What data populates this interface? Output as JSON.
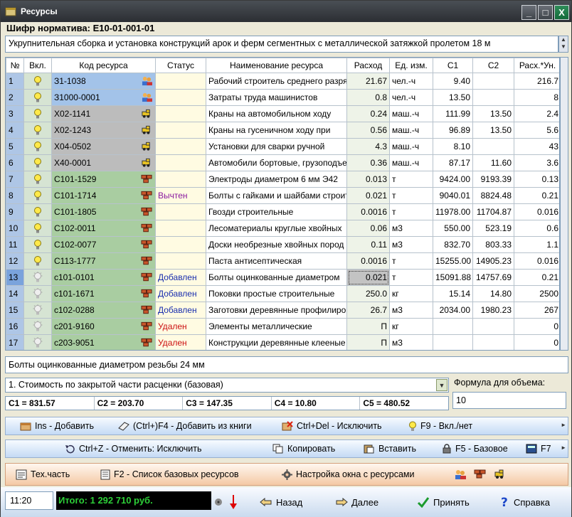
{
  "window": {
    "title": "Ресурсы",
    "minimize": "_",
    "maximize": "□",
    "close": "X"
  },
  "shifr": "Шифр норматива: Е10-01-001-01",
  "description": "Укрупнительная сборка и установка конструкций арок и ферм сегментных с металлической затяжкой пролетом 18 м",
  "columns": [
    "№",
    "Вкл.",
    "Код ресурса",
    "Статус",
    "Наименование ресурса",
    "Расход",
    "Ед. изм.",
    "С1",
    "С2",
    "Расх.*Ун."
  ],
  "rows": [
    {
      "n": "1",
      "on": true,
      "code": "З1-1038",
      "cat": "blue",
      "icon": "workers-icon",
      "status": "",
      "st": "",
      "name": "Рабочий строитель среднего разряда",
      "ras": "21.67",
      "ed": "чел.-ч",
      "c1": "9.40",
      "c2": "",
      "ru": "216.7"
    },
    {
      "n": "2",
      "on": true,
      "code": "З1000-0001",
      "cat": "blue",
      "icon": "workers-icon",
      "status": "",
      "st": "",
      "name": "Затраты труда машинистов",
      "ras": "0.8",
      "ed": "чел.-ч",
      "c1": "13.50",
      "c2": "",
      "ru": "8"
    },
    {
      "n": "3",
      "on": true,
      "code": "Х02-1141",
      "cat": "gray",
      "icon": "machine-icon",
      "status": "",
      "st": "",
      "name": "Краны на автомобильном ходу",
      "ras": "0.24",
      "ed": "маш.-ч",
      "c1": "111.99",
      "c2": "13.50",
      "ru": "2.4"
    },
    {
      "n": "4",
      "on": true,
      "code": "Х02-1243",
      "cat": "gray",
      "icon": "machine-icon",
      "status": "",
      "st": "",
      "name": "Краны на гусеничном ходу при",
      "ras": "0.56",
      "ed": "маш.-ч",
      "c1": "96.89",
      "c2": "13.50",
      "ru": "5.6"
    },
    {
      "n": "5",
      "on": true,
      "code": "Х04-0502",
      "cat": "gray",
      "icon": "machine-icon",
      "status": "",
      "st": "",
      "name": "Установки для сварки ручной",
      "ras": "4.3",
      "ed": "маш.-ч",
      "c1": "8.10",
      "c2": "",
      "ru": "43"
    },
    {
      "n": "6",
      "on": true,
      "code": "Х40-0001",
      "cat": "gray",
      "icon": "machine-icon",
      "status": "",
      "st": "",
      "name": "Автомобили бортовые, грузоподъемностью",
      "ras": "0.36",
      "ed": "маш.-ч",
      "c1": "87.17",
      "c2": "11.60",
      "ru": "3.6"
    },
    {
      "n": "7",
      "on": true,
      "code": "С101-1529",
      "cat": "green",
      "icon": "bricks-icon",
      "status": "",
      "st": "",
      "name": "Электроды диаметром 6 мм Э42",
      "ras": "0.013",
      "ed": "т",
      "c1": "9424.00",
      "c2": "9193.39",
      "ru": "0.13"
    },
    {
      "n": "8",
      "on": true,
      "code": "С101-1714",
      "cat": "green",
      "icon": "bricks-icon",
      "status": "Вычтен",
      "st": "purple",
      "name": "Болты с гайками и шайбами строительные",
      "ras": "0.021",
      "ed": "т",
      "c1": "9040.01",
      "c2": "8824.48",
      "ru": "0.21"
    },
    {
      "n": "9",
      "on": true,
      "code": "С101-1805",
      "cat": "green",
      "icon": "bricks-icon",
      "status": "",
      "st": "",
      "name": "Гвозди строительные",
      "ras": "0.0016",
      "ed": "т",
      "c1": "11978.00",
      "c2": "11704.87",
      "ru": "0.016"
    },
    {
      "n": "10",
      "on": true,
      "code": "С102-0011",
      "cat": "green",
      "icon": "bricks-icon",
      "status": "",
      "st": "",
      "name": "Лесоматериалы круглые хвойных",
      "ras": "0.06",
      "ed": "м3",
      "c1": "550.00",
      "c2": "523.19",
      "ru": "0.6"
    },
    {
      "n": "11",
      "on": true,
      "code": "С102-0077",
      "cat": "green",
      "icon": "bricks-icon",
      "status": "",
      "st": "",
      "name": "Доски необрезные хвойных пород",
      "ras": "0.11",
      "ed": "м3",
      "c1": "832.70",
      "c2": "803.33",
      "ru": "1.1"
    },
    {
      "n": "12",
      "on": true,
      "code": "С113-1777",
      "cat": "green",
      "icon": "bricks-icon",
      "status": "",
      "st": "",
      "name": "Паста антисептическая",
      "ras": "0.0016",
      "ed": "т",
      "c1": "15255.00",
      "c2": "14905.23",
      "ru": "0.016"
    },
    {
      "n": "13",
      "on": false,
      "code": "с101-0101",
      "cat": "green",
      "icon": "bricks-icon",
      "status": "Добавлен",
      "st": "blue",
      "name": "Болты оцинкованные диаметром",
      "ras": "0.021",
      "ed": "т",
      "c1": "15091.88",
      "c2": "14757.69",
      "ru": "0.21"
    },
    {
      "n": "14",
      "on": false,
      "code": "с101-1671",
      "cat": "green",
      "icon": "bricks-icon",
      "status": "Добавлен",
      "st": "blue",
      "name": "Поковки простые строительные",
      "ras": "250.0",
      "ed": "кг",
      "c1": "15.14",
      "c2": "14.80",
      "ru": "2500"
    },
    {
      "n": "15",
      "on": false,
      "code": "с102-0288",
      "cat": "green",
      "icon": "bricks-icon",
      "status": "Добавлен",
      "st": "blue",
      "name": "Заготовки деревянные профилированные",
      "ras": "26.7",
      "ed": "м3",
      "c1": "2034.00",
      "c2": "1980.23",
      "ru": "267"
    },
    {
      "n": "16",
      "on": false,
      "code": "с201-9160",
      "cat": "green",
      "icon": "bricks-icon",
      "status": "Удален",
      "st": "red",
      "name": "Элементы металлические",
      "ras": "П",
      "ed": "кг",
      "c1": "",
      "c2": "",
      "ru": "0"
    },
    {
      "n": "17",
      "on": false,
      "code": "с203-9051",
      "cat": "green",
      "icon": "bricks-icon",
      "status": "Удален",
      "st": "red",
      "name": "Конструкции деревянные клееные",
      "ras": "П",
      "ed": "м3",
      "c1": "",
      "c2": "",
      "ru": "0"
    }
  ],
  "selected_name": "Болты оцинкованные диаметром резьбы 24 мм",
  "cost_type": "1. Стоимость по закрытой части расценки (базовая)",
  "c_values": [
    "С1 = 831.57",
    "С2 = 203.70",
    "С3 = 147.35",
    "С4 = 10.80",
    "С5 = 480.52"
  ],
  "formula_label": "Формула для объема:",
  "formula_value": "10",
  "toolbar1": {
    "add": "Ins - Добавить",
    "add_book": "(Ctrl+)F4 - Добавить из книги",
    "exclude": "Ctrl+Del - Исключить",
    "toggle": "F9 - Вкл./нет"
  },
  "toolbar2": {
    "undo": "Ctrl+Z - Отменить: Исключить",
    "copy": "Копировать",
    "paste": "Вставить",
    "base": "F5 - Базовое",
    "f7": "F7"
  },
  "toolbar3": {
    "tech": "Тех.часть",
    "list": "F2 - Список базовых ресурсов",
    "settings": "Настройка окна с ресурсами"
  },
  "bottom": {
    "time": "11:20",
    "total": "Итого: 1 292 710 руб.",
    "back": "Назад",
    "next": "Далее",
    "accept": "Принять",
    "help": "Справка"
  },
  "colors": {
    "blue_code": "#a3c3e9",
    "gray_code": "#bcbcbc",
    "green_code": "#a9cda1",
    "status_added": "#1a2fae",
    "status_removed": "#c11",
    "status_subtracted": "#8a1aa0",
    "total_text": "#2dcf38"
  }
}
